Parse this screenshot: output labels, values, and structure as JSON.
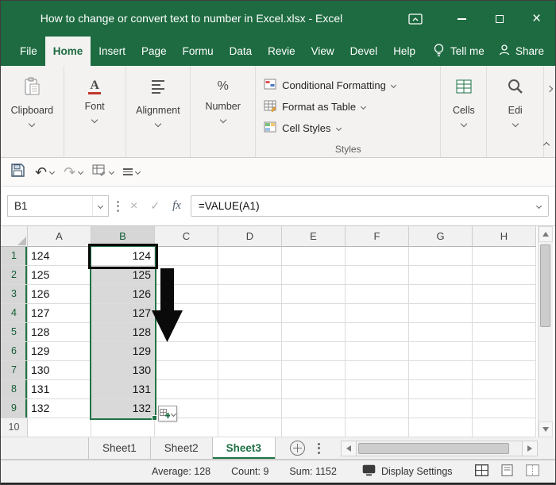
{
  "window": {
    "title": "How to change or convert text to number in Excel.xlsx - Excel"
  },
  "menu": {
    "tabs": [
      "File",
      "Home",
      "Insert",
      "Page",
      "Formu",
      "Data",
      "Revie",
      "View",
      "Devel",
      "Help"
    ],
    "active_tab": "Home",
    "tell_me_label": "Tell me",
    "share_label": "Share"
  },
  "ribbon": {
    "groups": {
      "clipboard": "Clipboard",
      "font": "Font",
      "alignment": "Alignment",
      "number": "Number",
      "cells": "Cells",
      "editing": "Edi"
    },
    "styles": {
      "caption": "Styles",
      "conditional_formatting": "Conditional Formatting",
      "format_as_table": "Format as Table",
      "cell_styles": "Cell Styles"
    }
  },
  "formula_bar": {
    "name_box_value": "B1",
    "formula": "=VALUE(A1)",
    "fx_label": "fx"
  },
  "grid": {
    "columns": [
      "A",
      "B",
      "C",
      "D",
      "E",
      "F",
      "G",
      "H"
    ],
    "selected_column": "B",
    "active_cell": "B1",
    "rows": [
      {
        "n": "1",
        "a": "124",
        "b": "124",
        "selected": true
      },
      {
        "n": "2",
        "a": "125",
        "b": "125",
        "selected": true
      },
      {
        "n": "3",
        "a": "126",
        "b": "126",
        "selected": true
      },
      {
        "n": "4",
        "a": "127",
        "b": "127",
        "selected": true
      },
      {
        "n": "5",
        "a": "128",
        "b": "128",
        "selected": true
      },
      {
        "n": "6",
        "a": "129",
        "b": "129",
        "selected": true
      },
      {
        "n": "7",
        "a": "130",
        "b": "130",
        "selected": true
      },
      {
        "n": "8",
        "a": "131",
        "b": "131",
        "selected": true
      },
      {
        "n": "9",
        "a": "132",
        "b": "132",
        "selected": true
      },
      {
        "n": "10",
        "a": "",
        "b": "",
        "selected": false
      }
    ]
  },
  "sheets": {
    "tabs": [
      "Sheet1",
      "Sheet2",
      "Sheet3"
    ],
    "active_tab": "Sheet3"
  },
  "status_bar": {
    "average": "Average: 128",
    "count": "Count: 9",
    "sum": "Sum: 1152",
    "display_settings": "Display Settings"
  },
  "icons_text": {
    "undo": "↶",
    "redo": "↷",
    "cancel": "×",
    "enter": "✓",
    "percent": "%",
    "font_letter": "A"
  },
  "colors": {
    "excel_green": "#1e6b41",
    "selection_border": "#217346",
    "selection_fill": "#d9d9d9",
    "annotation_black": "#0a0a0a"
  }
}
